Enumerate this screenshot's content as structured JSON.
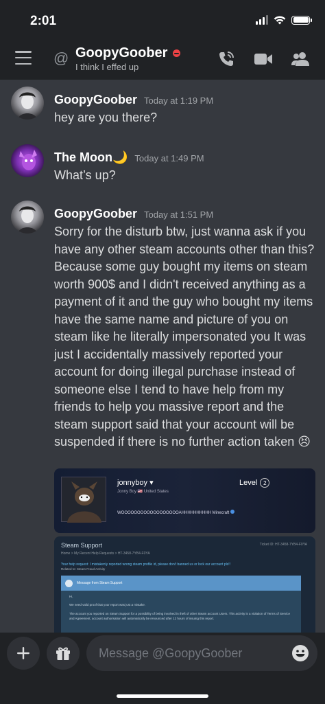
{
  "status_bar": {
    "time": "2:01"
  },
  "header": {
    "channel_name": "GoopyGoober",
    "custom_status": "I think I effed up",
    "icons": [
      "menu-icon",
      "at-icon",
      "dnd-status-icon",
      "call-icon",
      "video-icon",
      "members-icon"
    ]
  },
  "messages": [
    {
      "author": "GoopyGoober",
      "timestamp": "Today at 1:19 PM",
      "text": "hey are you there?"
    },
    {
      "author": "The Moon🌙",
      "timestamp": "Today at 1:49 PM",
      "text": "What’s up?"
    },
    {
      "author": "GoopyGoober",
      "timestamp": "Today at 1:51 PM",
      "text": "Sorry for the disturb btw, just wanna ask if you have any other steam accounts other than this? Because some guy bought my items on steam  worth 900$ and I didn't received anything as a payment of it and the guy who bought my items have the same name and picture of you on steam like he literally impersonated you It was just I accidentally massively reported your account for doing illegal purchase instead of someone else I tend to have help from my friends to help you massive report and the steam support said that your account will be suspended if there is no further action taken 😣"
    }
  ],
  "embed_profile": {
    "name": "jonnyboy",
    "subline": "Jonny Boy  🇺🇸 United States",
    "level_label": "Level",
    "level": "2",
    "description": "WOOOOOOOOOOOOOOOOOOAHHHHHHHHHH Minecraft"
  },
  "embed_support": {
    "title": "Steam Support",
    "ticket": "Ticket ID: HT-3458-7YB4-F0YA",
    "breadcrumb": "Home > My Recent Help Requests > HT-3458-7YB4-F0YA",
    "request": "Your help request: I mistakenly reported wrong steam profile id, please don't banned us or lock our account pls!!",
    "related": "Related to: Steam Fraud Activity",
    "box_header": "Message from Steam Support",
    "greeting": "Hi,",
    "para1": "We need valid proof that your report was just a mistake.",
    "para2": "The account you reported on Steam Support for a possibility of being involved in theft of other Steam account Users. This activity is a violation of Terms of Service and Agreement, account authorisation will automatically be renounced after 12 hours of issuing this report."
  },
  "composer": {
    "placeholder": "Message @GoopyGoober",
    "icons": [
      "plus-icon",
      "gift-icon",
      "emoji-icon"
    ]
  },
  "colors": {
    "background": "#36393f",
    "bars": "#202225",
    "dnd": "#ed4245",
    "link": "#66c0f4"
  }
}
